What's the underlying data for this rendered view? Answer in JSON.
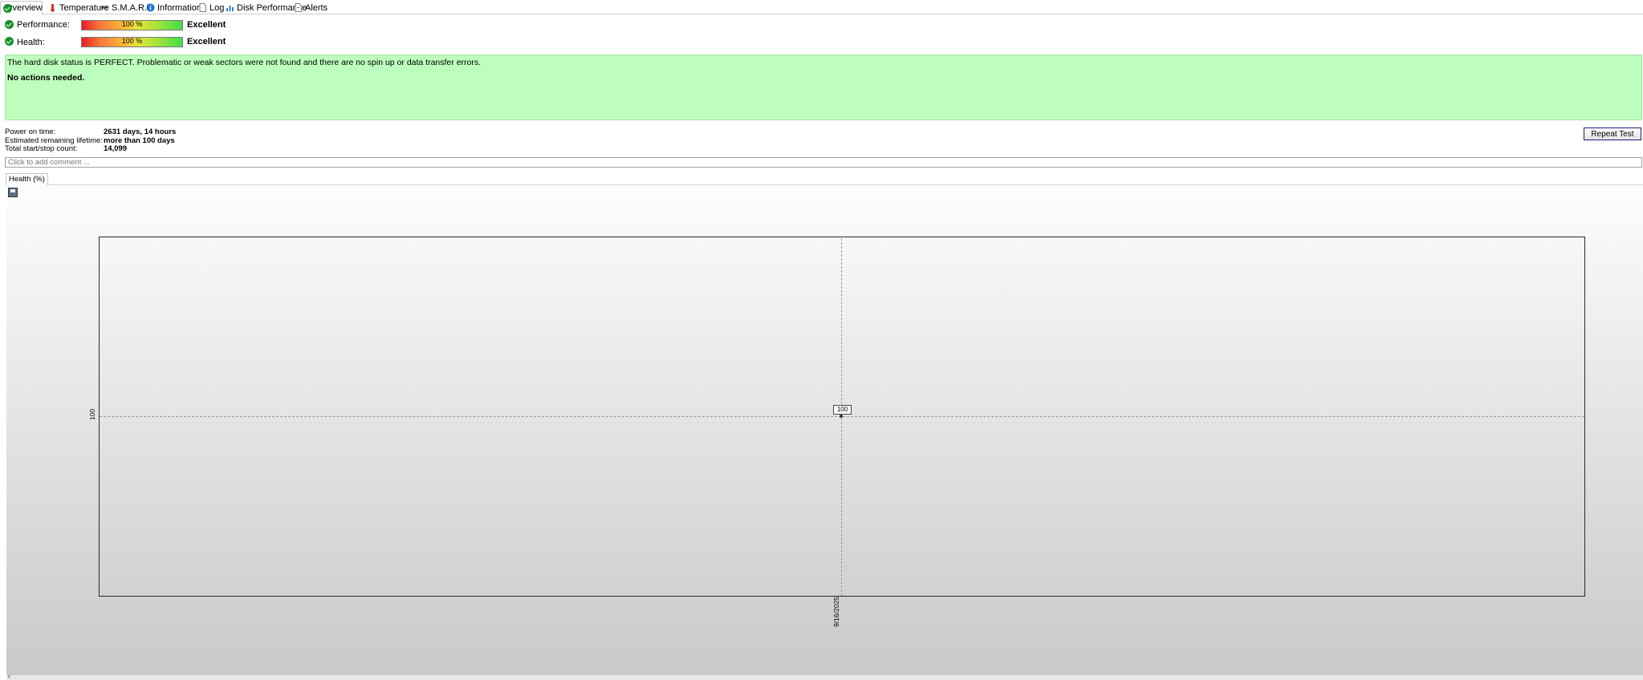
{
  "tabs": [
    {
      "label": "Overview",
      "icon": "check-circle-icon",
      "active": true
    },
    {
      "label": "Temperature",
      "icon": "thermometer-icon"
    },
    {
      "label": "S.M.A.R.T.",
      "icon": "minus-icon"
    },
    {
      "label": "Information",
      "icon": "info-icon"
    },
    {
      "label": "Log",
      "icon": "document-icon"
    },
    {
      "label": "Disk Performance",
      "icon": "chart-icon"
    },
    {
      "label": "Alerts",
      "icon": "alert-document-icon"
    }
  ],
  "metrics": {
    "performance": {
      "label": "Performance:",
      "value": "100 %",
      "progress": 1.0,
      "rating": "Excellent"
    },
    "health": {
      "label": "Health:",
      "value": "100 %",
      "progress": 1.0,
      "rating": "Excellent"
    }
  },
  "status": {
    "message": "The hard disk status is PERFECT. Problematic or weak sectors were not found and there are no spin up or data transfer errors.",
    "action": "No actions needed.",
    "color": "#bdfdbd"
  },
  "info": {
    "power_on_label": "Power on time:",
    "power_on_value": "2631 days, 14 hours",
    "lifetime_label": "Estimated remaining lifetime:",
    "lifetime_value": "more than 100 days",
    "startstop_label": "Total start/stop count:",
    "startstop_value": "14,099"
  },
  "repeat_button": "Repeat Test",
  "comment_placeholder": "Click to add comment ...",
  "chart_tab": "Health (%)",
  "chart_data": {
    "type": "line",
    "x": [
      "9/16/2025"
    ],
    "series": [
      {
        "values": [
          100
        ]
      }
    ],
    "ytick_labels": [
      "100"
    ],
    "xtick_labels": [
      "9/16/2025"
    ],
    "point_labels": [
      "100"
    ]
  }
}
